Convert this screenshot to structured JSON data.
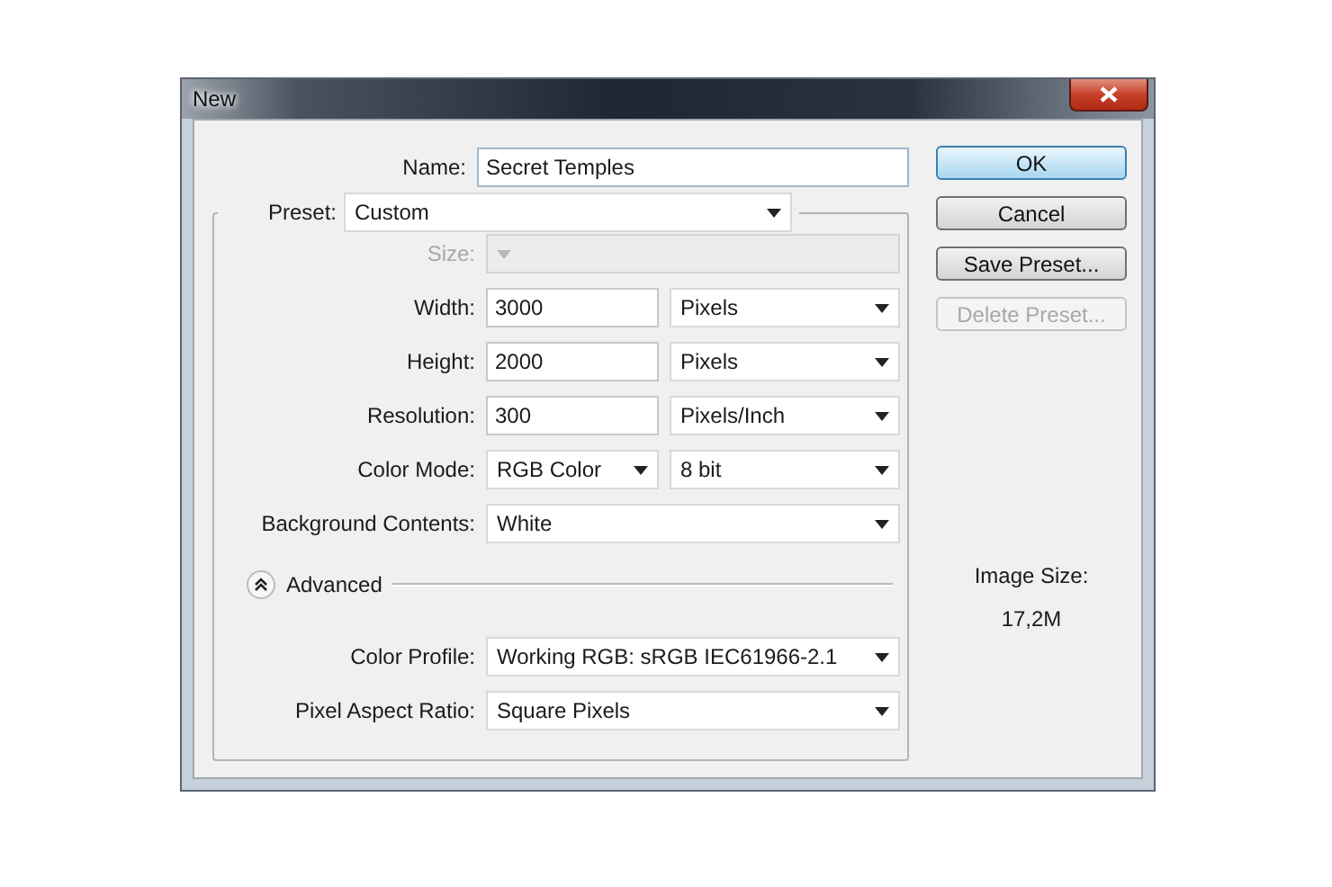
{
  "window": {
    "title": "New"
  },
  "name": {
    "label": "Name:",
    "value": "Secret Temples"
  },
  "preset": {
    "label": "Preset:",
    "value": "Custom"
  },
  "fields": [
    {
      "kind": "select",
      "label": "Size:",
      "disabled": true
    },
    {
      "kind": "input-unit",
      "label": "Width:",
      "value": "3000",
      "unit": "Pixels",
      "disabled": false
    },
    {
      "kind": "input-unit",
      "label": "Height:",
      "value": "2000",
      "unit": "Pixels",
      "disabled": false
    },
    {
      "kind": "input-unit",
      "label": "Resolution:",
      "value": "300",
      "unit": "Pixels/Inch",
      "disabled": false
    },
    {
      "kind": "select-pair",
      "label": "Color Mode:",
      "value": "RGB Color",
      "unit": "8 bit",
      "disabled": false
    },
    {
      "kind": "select",
      "label": "Background Contents:",
      "value": "White",
      "disabled": false
    }
  ],
  "advanced": {
    "label": "Advanced",
    "expanded": true
  },
  "advanced_fields": [
    {
      "kind": "select",
      "label": "Color Profile:",
      "value": "Working RGB:  sRGB IEC61966-2.1",
      "disabled": false
    },
    {
      "kind": "select",
      "label": "Pixel Aspect Ratio:",
      "value": "Square Pixels",
      "disabled": false
    }
  ],
  "buttons": [
    {
      "label": "OK",
      "default": true,
      "disabled": false
    },
    {
      "label": "Cancel",
      "default": false,
      "disabled": false
    },
    {
      "label": "Save Preset...",
      "default": false,
      "disabled": false
    },
    {
      "label": "Delete Preset...",
      "default": false,
      "disabled": true
    }
  ],
  "image_size": {
    "label": "Image Size:",
    "value": "17,2M"
  }
}
